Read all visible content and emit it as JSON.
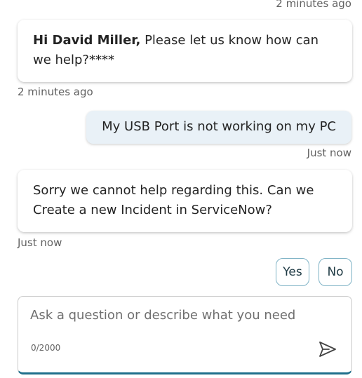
{
  "messages": [
    {
      "kind": "timestamp",
      "text": "2 minutes ago"
    },
    {
      "kind": "bot",
      "name": "Hi David Miller,",
      "text": "Please let us know how can we help?****",
      "time": "2 minutes ago"
    },
    {
      "kind": "user",
      "text": "My USB Port is not working on my PC",
      "time": "Just now"
    },
    {
      "kind": "bot",
      "text": "Sorry we cannot help regarding this. Can we Create a new Incident in ServiceNow?",
      "time": "Just now"
    }
  ],
  "quick_replies": [
    {
      "label": "Yes"
    },
    {
      "label": "No"
    }
  ],
  "composer": {
    "placeholder": "Ask a question or describe what you need",
    "value": "",
    "counter": "0/2000",
    "send_icon": "send-icon"
  },
  "colors": {
    "user_bubble": "#e9f1f7",
    "accent": "#1f6f8b",
    "quick_reply_border": "#7fb3c6"
  }
}
